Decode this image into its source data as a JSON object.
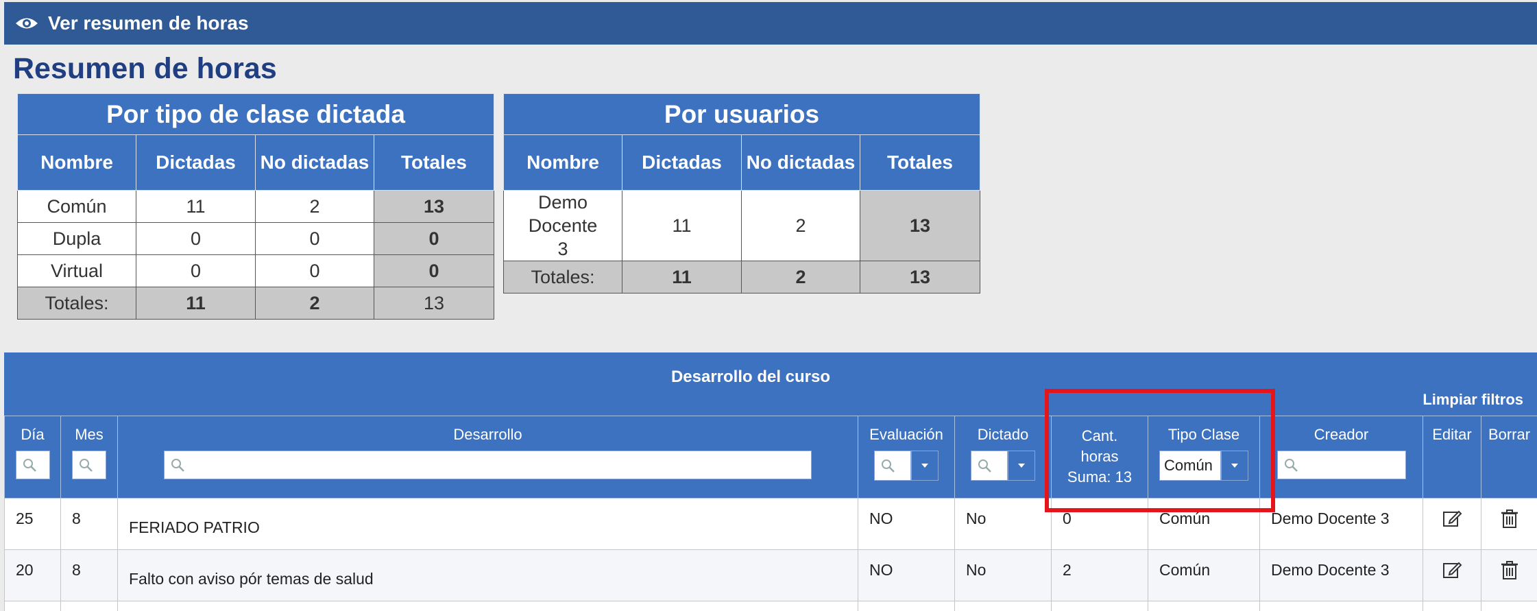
{
  "topbar": {
    "label": "Ver resumen de horas",
    "icon": "eye-icon"
  },
  "page_title": "Resumen de horas",
  "tipo_table": {
    "caption": "Por tipo de clase dictada",
    "headers": [
      "Nombre",
      "Dictadas",
      "No dictadas",
      "Totales"
    ],
    "rows": [
      {
        "nombre": "Común",
        "dictadas": "11",
        "no_dictadas": "2",
        "totales": "13"
      },
      {
        "nombre": "Dupla",
        "dictadas": "0",
        "no_dictadas": "0",
        "totales": "0"
      },
      {
        "nombre": "Virtual",
        "dictadas": "0",
        "no_dictadas": "0",
        "totales": "0"
      }
    ],
    "footer": {
      "label": "Totales:",
      "dictadas": "11",
      "no_dictadas": "2",
      "totales": "13"
    }
  },
  "usuarios_table": {
    "caption": "Por usuarios",
    "headers": [
      "Nombre",
      "Dictadas",
      "No dictadas",
      "Totales"
    ],
    "rows": [
      {
        "nombre": "Demo Docente 3",
        "dictadas": "11",
        "no_dictadas": "2",
        "totales": "13"
      }
    ],
    "footer": {
      "label": "Totales:",
      "dictadas": "11",
      "no_dictadas": "2",
      "totales": "13"
    }
  },
  "desarrollo": {
    "title": "Desarrollo del curso",
    "clear_filters": "Limpiar filtros",
    "columns": {
      "dia": "Día",
      "mes": "Mes",
      "desarrollo": "Desarrollo",
      "evaluacion": "Evaluación",
      "dictado": "Dictado",
      "cant_horas": "Cant. horas",
      "suma": "Suma: 13",
      "tipo_clase": "Tipo Clase",
      "tipo_clase_selected": "Común",
      "creador": "Creador",
      "editar": "Editar",
      "borrar": "Borrar"
    },
    "rows": [
      {
        "dia": "25",
        "mes": "8",
        "desarrollo": "FERIADO PATRIO",
        "evaluacion": "NO",
        "dictado": "No",
        "cant_horas": "0",
        "tipo_clase": "Común",
        "creador": "Demo Docente 3"
      },
      {
        "dia": "20",
        "mes": "8",
        "desarrollo": "Falto con aviso pór temas de salud",
        "evaluacion": "NO",
        "dictado": "No",
        "cant_horas": "2",
        "tipo_clase": "Común",
        "creador": "Demo Docente 3"
      }
    ]
  },
  "colors": {
    "header_blue": "#3d72c1",
    "topbar_blue": "#2f5a96",
    "highlight_red": "#e4151b",
    "total_gray": "#c8c8c8"
  }
}
